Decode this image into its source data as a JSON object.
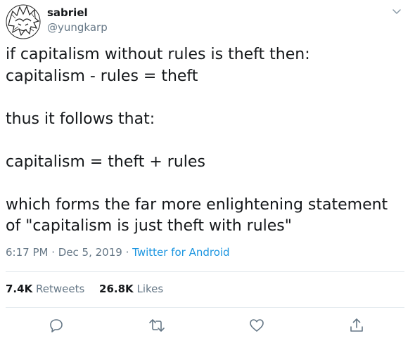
{
  "author": {
    "display_name": "sabriel",
    "handle": "@yungkarp"
  },
  "tweet": {
    "text": "if capitalism without rules is theft then:\ncapitalism - rules = theft\n\nthus it follows that:\n\ncapitalism = theft + rules\n\nwhich forms the far more enlightening statement\nof \"capitalism is just theft with rules\"",
    "time": "6:17 PM",
    "separator": " · ",
    "date": "Dec 5, 2019",
    "source": "Twitter for Android"
  },
  "stats": {
    "retweets_count": "7.4K",
    "retweets_label": "Retweets",
    "likes_count": "26.8K",
    "likes_label": "Likes"
  },
  "icons": {
    "caret": "chevron-down-icon",
    "reply": "reply-icon",
    "retweet": "retweet-icon",
    "like": "heart-icon",
    "share": "share-icon"
  },
  "colors": {
    "text": "#14171a",
    "secondary": "#657786",
    "link": "#1b95e0",
    "divider": "#e6ecf0"
  }
}
